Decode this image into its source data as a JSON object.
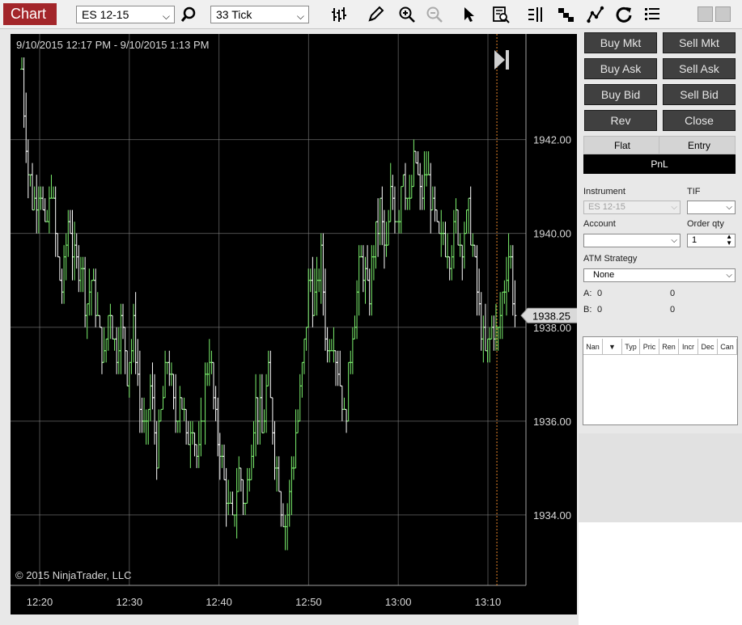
{
  "toolbar": {
    "title": "Chart",
    "instrument": "ES 12-15",
    "interval": "33 Tick",
    "icons": [
      "search-icon",
      "bar-style-icon",
      "pencil-icon",
      "zoom-in-icon",
      "zoom-out-icon",
      "pointer-icon",
      "data-box-icon",
      "columns-icon",
      "order-flow-icon",
      "indicators-icon",
      "refresh-icon",
      "list-icon"
    ]
  },
  "chart": {
    "date_range": "9/10/2015 12:17 PM - 9/10/2015 1:13 PM",
    "copyright": "© 2015 NinjaTrader, LLC",
    "last_price_label": "1938.25",
    "colors": {
      "background": "#000000",
      "grid": "#8c8c8c",
      "up": "#7cf06e",
      "down": "#ffffff",
      "vline": "#e8852a"
    }
  },
  "chart_data": {
    "type": "ohlc",
    "xlabel": "",
    "ylabel": "",
    "y_ticks": [
      1934.0,
      1936.0,
      1938.0,
      1940.0,
      1942.0
    ],
    "x_ticks": [
      "12:20",
      "12:30",
      "12:40",
      "12:50",
      "13:00",
      "13:10"
    ],
    "ylim": [
      1932.5,
      1944.25
    ],
    "last_price": 1938.25,
    "price_path": [
      1943.5,
      1941.5,
      1940.5,
      1941.25,
      1939.75,
      1941,
      1939.5,
      1938.75,
      1940.5,
      1939.25,
      1939.5,
      1938.5,
      1939,
      1938,
      1937.25,
      1938.5,
      1937.5,
      1938.25,
      1937,
      1938,
      1936.5,
      1935.5,
      1936.75,
      1935.25,
      1936.5,
      1937.5,
      1936,
      1936.75,
      1935.5,
      1936.25,
      1935,
      1936.5,
      1937.5,
      1936,
      1935.25,
      1934.25,
      1933.75,
      1935,
      1934,
      1935.5,
      1936.5,
      1935.75,
      1937,
      1935.5,
      1934.5,
      1933.75,
      1935,
      1936,
      1937.5,
      1939,
      1938.5,
      1939.5,
      1937.5,
      1938,
      1937,
      1936,
      1937.5,
      1938.75,
      1939.5,
      1938.5,
      1939.75,
      1940.5,
      1939.5,
      1941,
      1940.25,
      1941.5,
      1940.5,
      1941.75,
      1940.75,
      1941.25,
      1940.5,
      1939.75,
      1940,
      1939.5,
      1940.25,
      1939.75,
      1940.5,
      1939.5,
      1938.25,
      1937.25,
      1938,
      1937.75,
      1938.75,
      1939.75,
      1938.25
    ],
    "vertical_line_at": "13:11"
  },
  "orders": {
    "buy_mkt": "Buy Mkt",
    "sell_mkt": "Sell Mkt",
    "buy_ask": "Buy Ask",
    "sell_ask": "Sell Ask",
    "buy_bid": "Buy Bid",
    "sell_bid": "Sell Bid",
    "rev": "Rev",
    "close": "Close"
  },
  "position": {
    "state": "Flat",
    "entry": "Entry",
    "pnl": "PnL"
  },
  "form": {
    "instrument_label": "Instrument",
    "instrument_value": "ES 12-15",
    "tif_label": "TIF",
    "tif_value": "",
    "account_label": "Account",
    "account_value": "",
    "qty_label": "Order qty",
    "qty_value": "1",
    "atm_label": "ATM Strategy",
    "atm_value": "None",
    "a_label": "A:",
    "a_val1": "0",
    "a_val2": "0",
    "b_label": "B:",
    "b_val1": "0",
    "b_val2": "0"
  },
  "grid_columns": [
    "Nan",
    "",
    "Typ",
    "Pric",
    "Ren",
    "Incr",
    "Dec",
    "Can"
  ]
}
